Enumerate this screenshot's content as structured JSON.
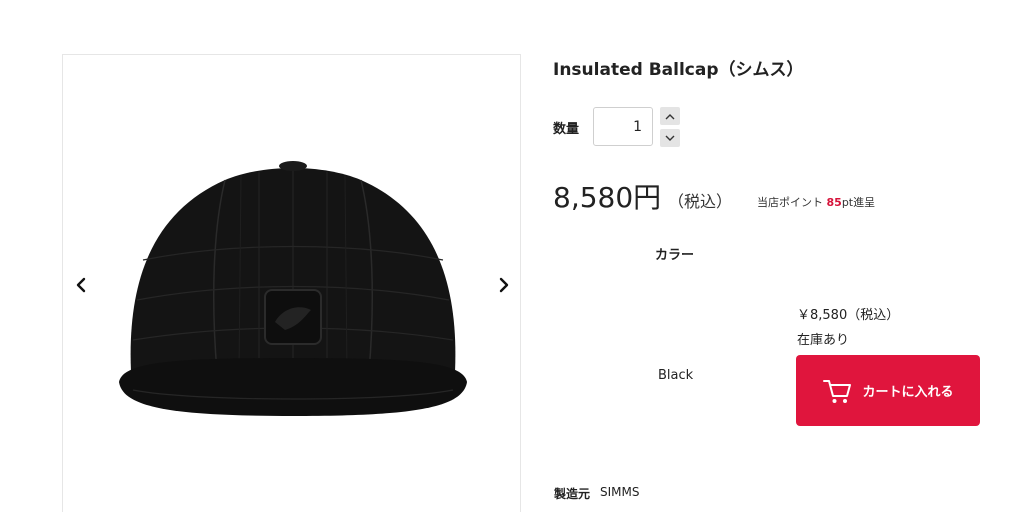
{
  "product": {
    "title": "Insulated Ballcap（シムス）",
    "quantity_label": "数量",
    "quantity_value": "1",
    "price": "8,580円",
    "price_tax_note": "（税込）",
    "points_prefix": "当店ポイント",
    "points_value": "85",
    "points_suffix": "pt進呈",
    "color_label": "カラー",
    "maker_label": "製造元",
    "maker_value": "SIMMS"
  },
  "variant": {
    "name": "Black",
    "price": "￥8,580（税込）",
    "stock": "在庫あり",
    "cart_button_label": "カートに入れる"
  },
  "colors": {
    "accent": "#e0153d",
    "points_highlight": "#d6133a",
    "product_cap": "#111111"
  },
  "icons": {
    "prev": "chevron-left-icon",
    "next": "chevron-right-icon",
    "cart": "cart-icon",
    "stepper_up": "chevron-up-icon",
    "stepper_down": "chevron-down-icon"
  }
}
